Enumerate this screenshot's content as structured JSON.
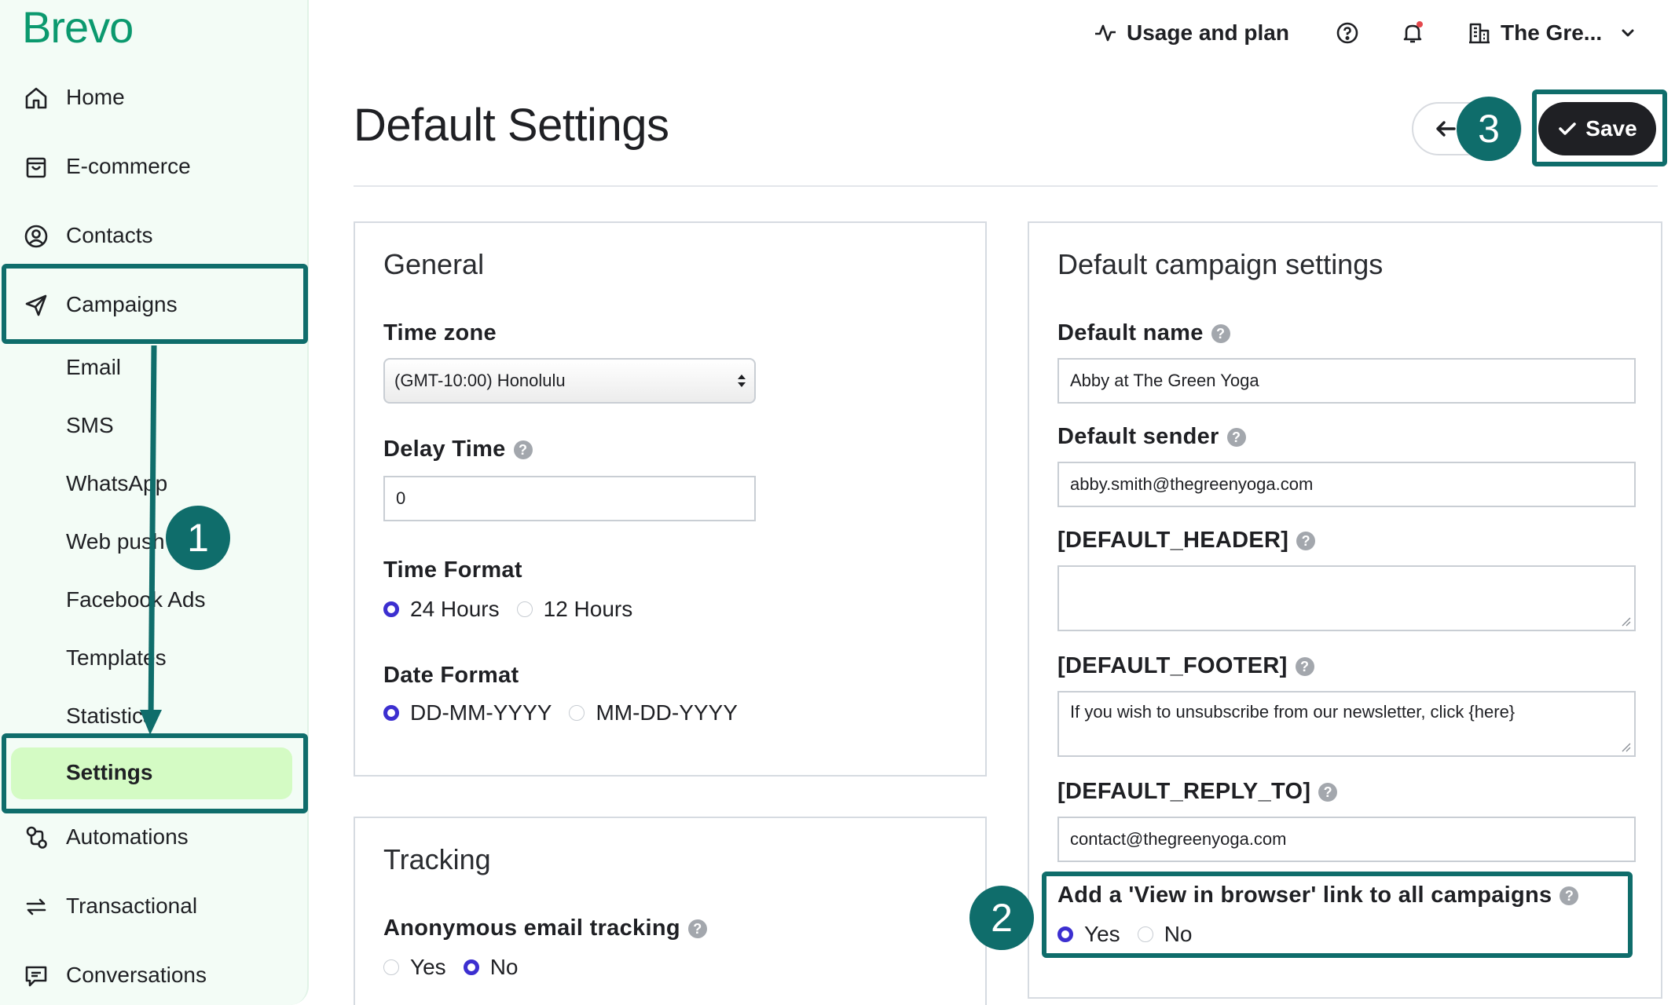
{
  "app": {
    "logo": "Brevo"
  },
  "sidebar": {
    "items": [
      {
        "label": "Home",
        "icon": "home-icon"
      },
      {
        "label": "E-commerce",
        "icon": "shopping-bag-icon"
      },
      {
        "label": "Contacts",
        "icon": "user-circle-icon"
      },
      {
        "label": "Campaigns",
        "icon": "paper-plane-icon"
      }
    ],
    "campaign_subitems": [
      "Email",
      "SMS",
      "WhatsApp",
      "Web push",
      "Facebook Ads",
      "Templates",
      "Statistics"
    ],
    "active_subitem": "Settings",
    "bottom_items": [
      {
        "label": "Automations",
        "icon": "automation-icon"
      },
      {
        "label": "Transactional",
        "icon": "arrows-exchange-icon"
      },
      {
        "label": "Conversations",
        "icon": "chat-icon"
      }
    ]
  },
  "topbar": {
    "usage_label": "Usage and plan",
    "account_label": "The Gre..."
  },
  "page": {
    "title": "Default Settings",
    "save_label": "Save"
  },
  "general": {
    "title": "General",
    "timezone_label": "Time zone",
    "timezone_value": "(GMT-10:00) Honolulu",
    "delay_label": "Delay Time",
    "delay_value": "0",
    "time_format_label": "Time Format",
    "time_format_options": [
      "24 Hours",
      "12 Hours"
    ],
    "time_format_selected": "24 Hours",
    "date_format_label": "Date Format",
    "date_format_options": [
      "DD-MM-YYYY",
      "MM-DD-YYYY"
    ],
    "date_format_selected": "DD-MM-YYYY"
  },
  "tracking": {
    "title": "Tracking",
    "anon_label": "Anonymous email tracking",
    "anon_options": [
      "Yes",
      "No"
    ],
    "anon_selected": "No"
  },
  "campaign_defaults": {
    "title": "Default campaign settings",
    "name_label": "Default name",
    "name_value": "Abby at The Green Yoga",
    "sender_label": "Default sender",
    "sender_value": "abby.smith@thegreenyoga.com",
    "header_label": "[DEFAULT_HEADER]",
    "header_value": "",
    "footer_label": "[DEFAULT_FOOTER]",
    "footer_value": "If you wish to unsubscribe from our newsletter, click {here}",
    "reply_label": "[DEFAULT_REPLY_TO]",
    "reply_value": "contact@thegreenyoga.com",
    "browser_link_label": "Add a 'View in browser' link to all campaigns",
    "browser_link_options": [
      "Yes",
      "No"
    ],
    "browser_link_selected": "Yes"
  },
  "annotations": {
    "step1": "1",
    "step2": "2",
    "step3": "3"
  },
  "colors": {
    "brand": "#0b996e",
    "annotation": "#0f6d6b",
    "active_nav": "#d4fbc4",
    "radio_on": "#3c2fd0",
    "sidebar_bg": "#f3fcf6"
  }
}
